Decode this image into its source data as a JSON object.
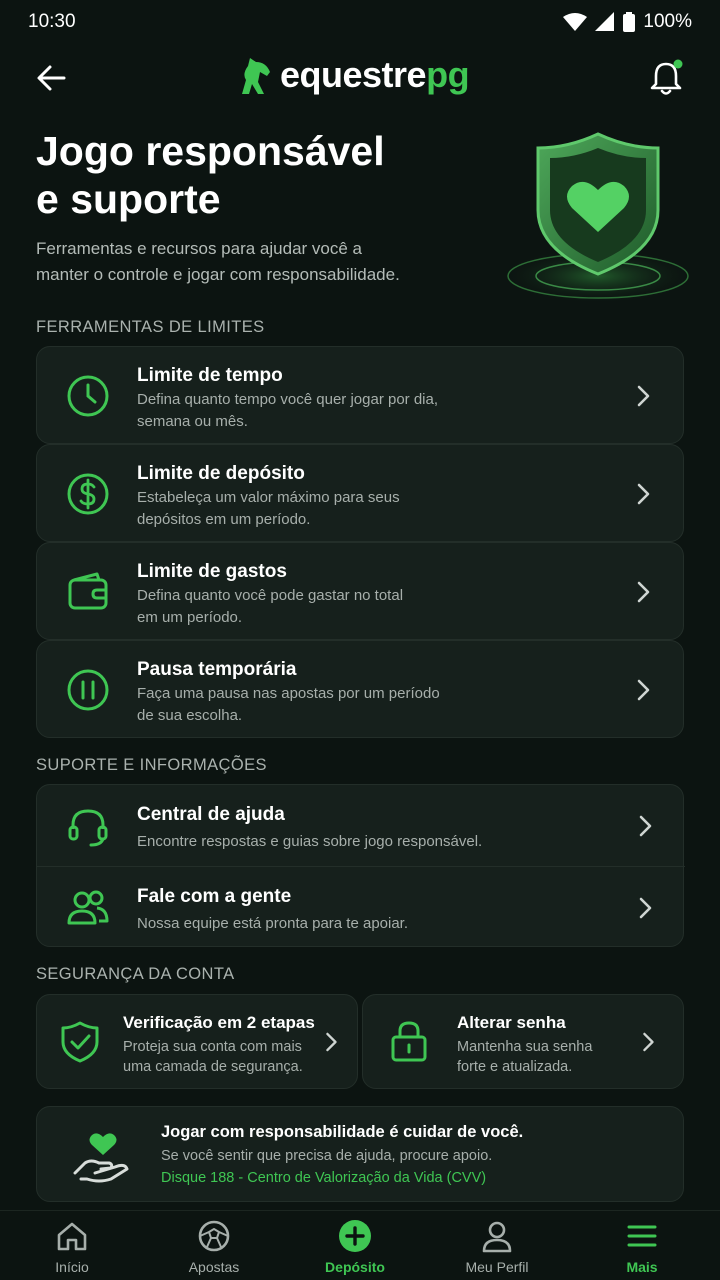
{
  "status": {
    "time": "10:30",
    "battery": "100%"
  },
  "brand": {
    "name_main": "equestre",
    "name_accent": "pg"
  },
  "hero": {
    "title": "Jogo responsável\ne suporte",
    "subtitle": "Ferramentas e recursos para ajudar você a\nmanter o controle e jogar com responsabilidade."
  },
  "limits": {
    "section": "FERRAMENTAS DE LIMITES",
    "items": [
      {
        "title": "Limite de tempo",
        "desc": "Defina quanto tempo você quer jogar por dia,\nsemana ou mês.",
        "icon": "clock-icon"
      },
      {
        "title": "Limite de depósito",
        "desc": "Estabeleça um valor máximo para seus\ndepósitos em um período.",
        "icon": "dollar-icon"
      },
      {
        "title": "Limite de gastos",
        "desc": "Defina quanto você pode gastar no total\nem um período.",
        "icon": "wallet-icon"
      },
      {
        "title": "Pausa temporária",
        "desc": "Faça uma pausa nas apostas por um período\nde sua escolha.",
        "icon": "pause-icon"
      }
    ]
  },
  "support": {
    "section": "SUPORTE E INFORMAÇÕES",
    "items": [
      {
        "title": "Central de ajuda",
        "desc": "Encontre respostas e guias sobre jogo responsável.",
        "icon": "headset-icon"
      },
      {
        "title": "Fale com a gente",
        "desc": "Nossa equipe está pronta para te apoiar.",
        "icon": "users-icon"
      }
    ]
  },
  "security": {
    "section": "SEGURANÇA DA CONTA",
    "items": [
      {
        "title": "Verificação em 2 etapas",
        "desc": "Proteja sua conta com mais\numa camada de segurança.",
        "icon": "shield-check-icon"
      },
      {
        "title": "Alterar senha",
        "desc": "Mantenha sua senha\nforte e atualizada.",
        "icon": "lock-icon"
      }
    ]
  },
  "banner": {
    "title": "Jogar com responsabilidade é cuidar de você.",
    "text": "Se você sentir que precisa de ajuda, procure apoio.",
    "link": "Disque 188 - Centro de Valorização da Vida (CVV)"
  },
  "tabs": [
    {
      "label": "Início",
      "icon": "home-icon"
    },
    {
      "label": "Apostas",
      "icon": "ball-icon"
    },
    {
      "label": "Depósito",
      "icon": "plus-circle-icon"
    },
    {
      "label": "Meu Perfil",
      "icon": "profile-icon"
    },
    {
      "label": "Mais",
      "icon": "menu-icon"
    }
  ],
  "colors": {
    "accent": "#3fc653",
    "background": "#0c1411",
    "card": "#16201c"
  }
}
